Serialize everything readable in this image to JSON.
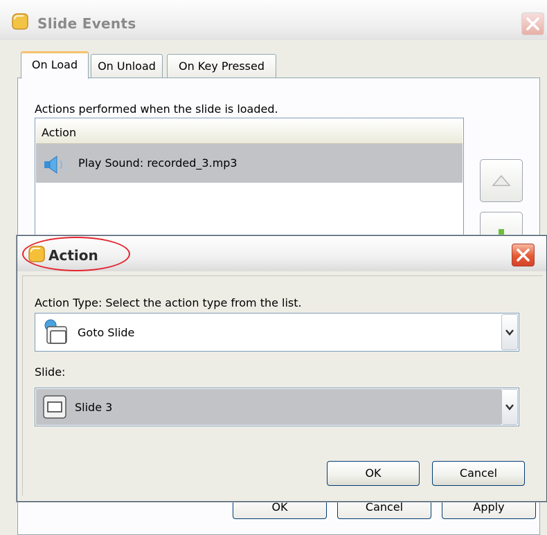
{
  "background_window": {
    "title": "Slide Events",
    "tabs": [
      {
        "label": "On Load",
        "active": true
      },
      {
        "label": "On Unload",
        "active": false
      },
      {
        "label": "On Key Pressed",
        "active": false
      }
    ],
    "caption": "Actions performed when the slide is loaded.",
    "list": {
      "column_header": "Action",
      "rows": [
        {
          "label": "Play Sound: recorded_3.mp3",
          "icon": "speaker-icon",
          "selected": true
        }
      ]
    },
    "buttons": {
      "ok": "OK",
      "cancel": "Cancel",
      "apply": "Apply"
    }
  },
  "dialog": {
    "title": "Action",
    "title_highlight_color": "#e4232d",
    "action_type": {
      "caption": "Action Type: Select the action type from the list.",
      "selected": "Goto Slide",
      "icon": "goto-slide-icon"
    },
    "slide": {
      "caption": "Slide:",
      "selected": "Slide 3",
      "icon": "slide-icon"
    },
    "buttons": {
      "ok": "OK",
      "cancel": "Cancel"
    }
  },
  "colors": {
    "selection": "#c2c3c7",
    "close_button": "#e35a33",
    "dialog_face": "#eeede5"
  }
}
